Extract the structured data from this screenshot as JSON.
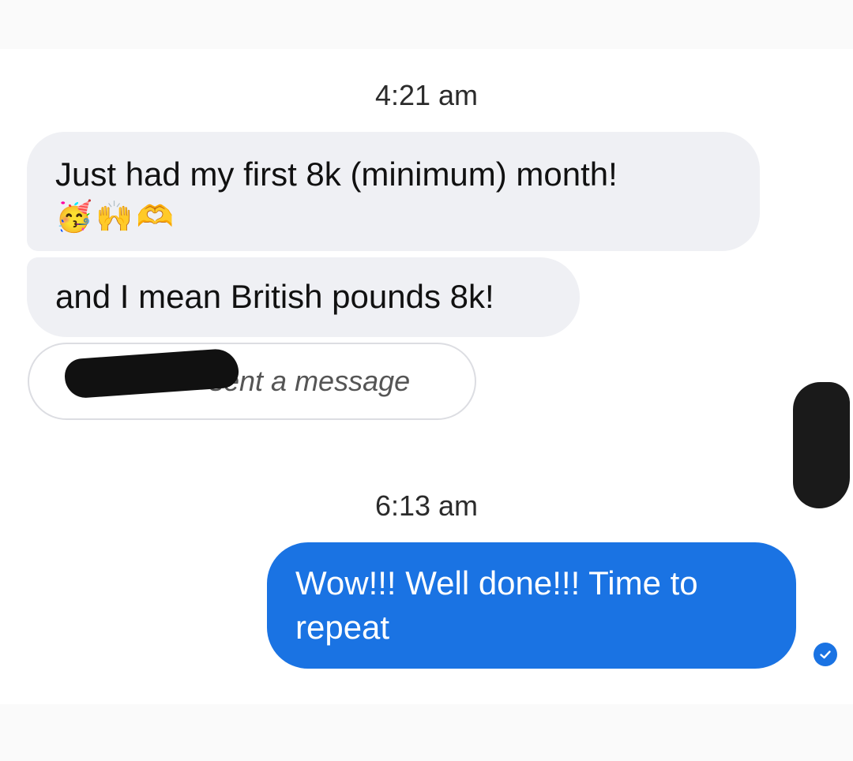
{
  "conversation": {
    "timestamps": [
      "4:21 am",
      "6:13 am"
    ],
    "incoming": [
      {
        "text": "Just had my first 8k (minimum) month!",
        "emojis": [
          "🥳",
          "🙌",
          "🫶"
        ]
      },
      {
        "text": "and I mean British pounds 8k!"
      }
    ],
    "system_notice": "sent a message",
    "outgoing": {
      "text": "Wow!!! Well done!!! Time to repeat"
    },
    "colors": {
      "incoming_bg": "#eff0f4",
      "outgoing_bg": "#1a73e3",
      "read_icon": "#1a73e3"
    },
    "read_receipt_icon": "check-circle-icon"
  }
}
